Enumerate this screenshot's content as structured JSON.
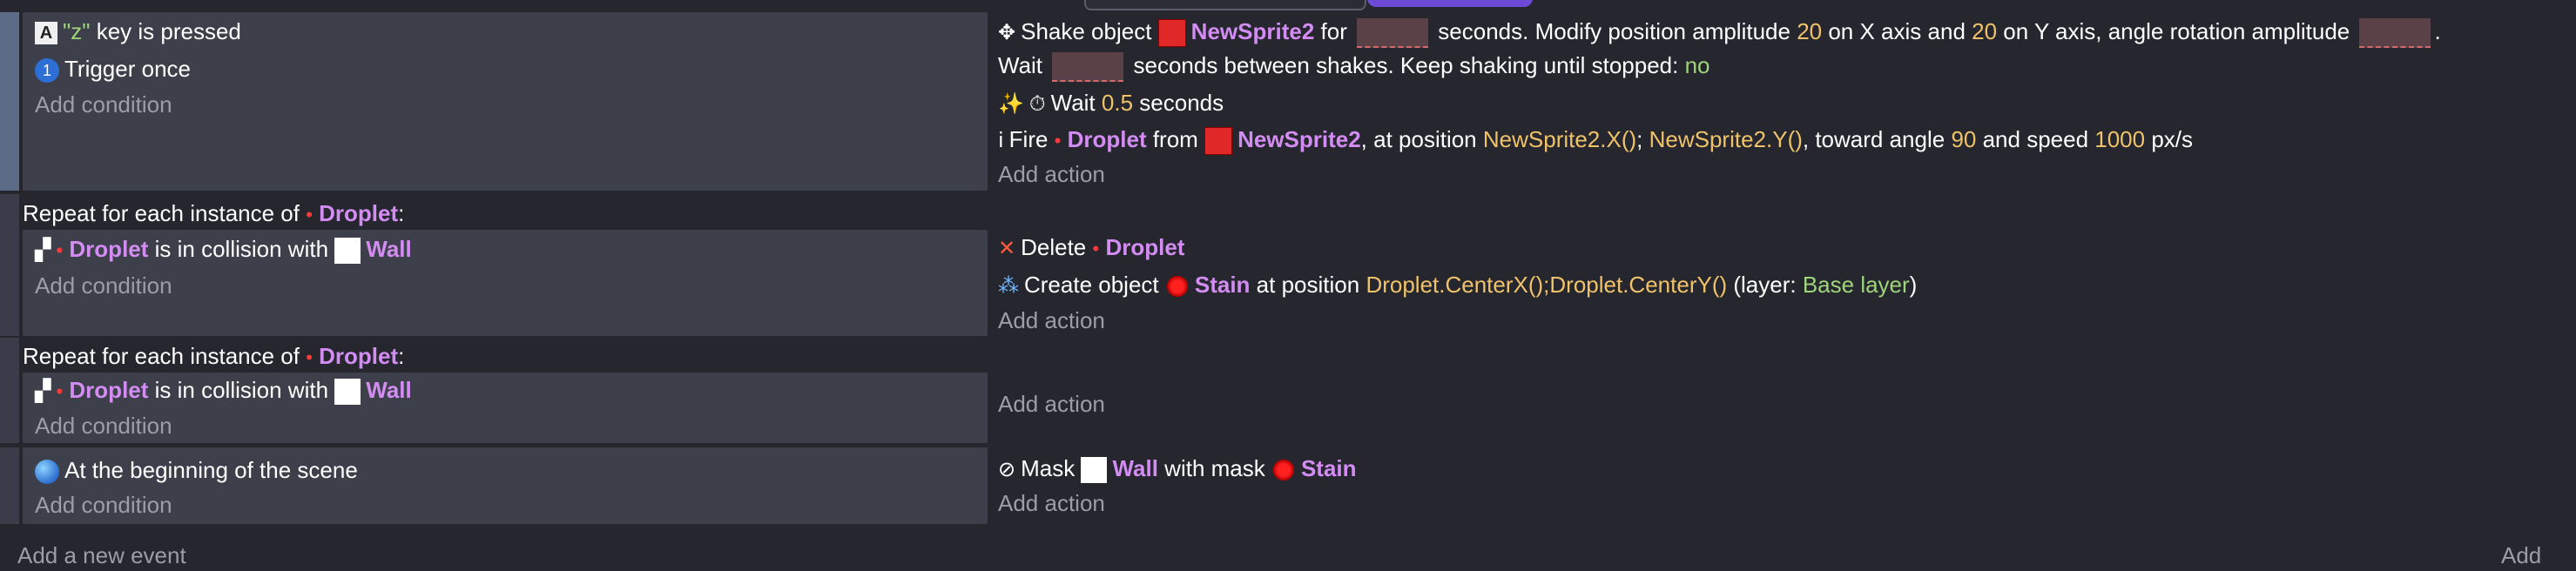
{
  "event1": {
    "conditions": {
      "c1_pre": "\"z\"",
      "c1_post": " key is pressed",
      "c2": "Trigger once",
      "add": "Add condition"
    },
    "actions": {
      "shake_a": "Shake object",
      "shake_obj": "NewSprite2",
      "shake_b": " for ",
      "shake_c": " seconds. Modify position amplitude ",
      "amp_x": "20",
      "shake_d": " on X axis and ",
      "amp_y": "20",
      "shake_e": " on Y axis, angle rotation amplitude ",
      "shake_f": ".",
      "wait_a": "Wait ",
      "wait_b": " seconds between shakes. Keep shaking until stopped: ",
      "keep": "no",
      "wait2_label": "Wait ",
      "wait2_value": "0.5",
      "wait2_unit": " seconds",
      "fire_a": "Fire ",
      "fire_obj": "Droplet",
      "fire_b": " from ",
      "fire_src": "NewSprite2",
      "fire_c": ", at position ",
      "fire_x": "NewSprite2.X()",
      "fire_sep": "; ",
      "fire_y": "NewSprite2.Y()",
      "fire_d": ", toward angle ",
      "fire_angle": "90",
      "fire_e": " and speed ",
      "fire_speed": "1000",
      "fire_f": " px/s",
      "add": "Add action"
    }
  },
  "event2": {
    "repeat_a": "Repeat for each instance of ",
    "repeat_obj": "Droplet",
    "repeat_b": ":",
    "cond_obj": "Droplet",
    "cond_a": " is in collision with ",
    "cond_wall": "Wall",
    "add_condition": "Add condition",
    "del_a": "Delete ",
    "del_obj": "Droplet",
    "create_a": "Create object ",
    "create_obj": "Stain",
    "create_b": " at position ",
    "create_expr": "Droplet.CenterX();Droplet.CenterY()",
    "create_c": " (layer: ",
    "create_layer": "Base layer",
    "create_d": ")",
    "add_action": "Add action"
  },
  "event3": {
    "repeat_a": "Repeat for each instance of ",
    "repeat_obj": "Droplet",
    "repeat_b": ":",
    "cond_obj": "Droplet",
    "cond_a": " is in collision with ",
    "cond_wall": "Wall",
    "add_condition": "Add condition",
    "add_action": "Add action"
  },
  "event4": {
    "cond": "At the beginning of the scene",
    "add_condition": "Add condition",
    "mask_a": "Mask ",
    "mask_obj": "Wall",
    "mask_b": " with mask ",
    "mask_stain": "Stain",
    "add_action": "Add action"
  },
  "footer": {
    "add_event": "Add a new event",
    "add": "Add"
  },
  "colors": {
    "object": "#d38cf2",
    "number": "#f0c36a",
    "string": "#9ed47a",
    "panel": "#3d404b",
    "background": "#25262e"
  }
}
